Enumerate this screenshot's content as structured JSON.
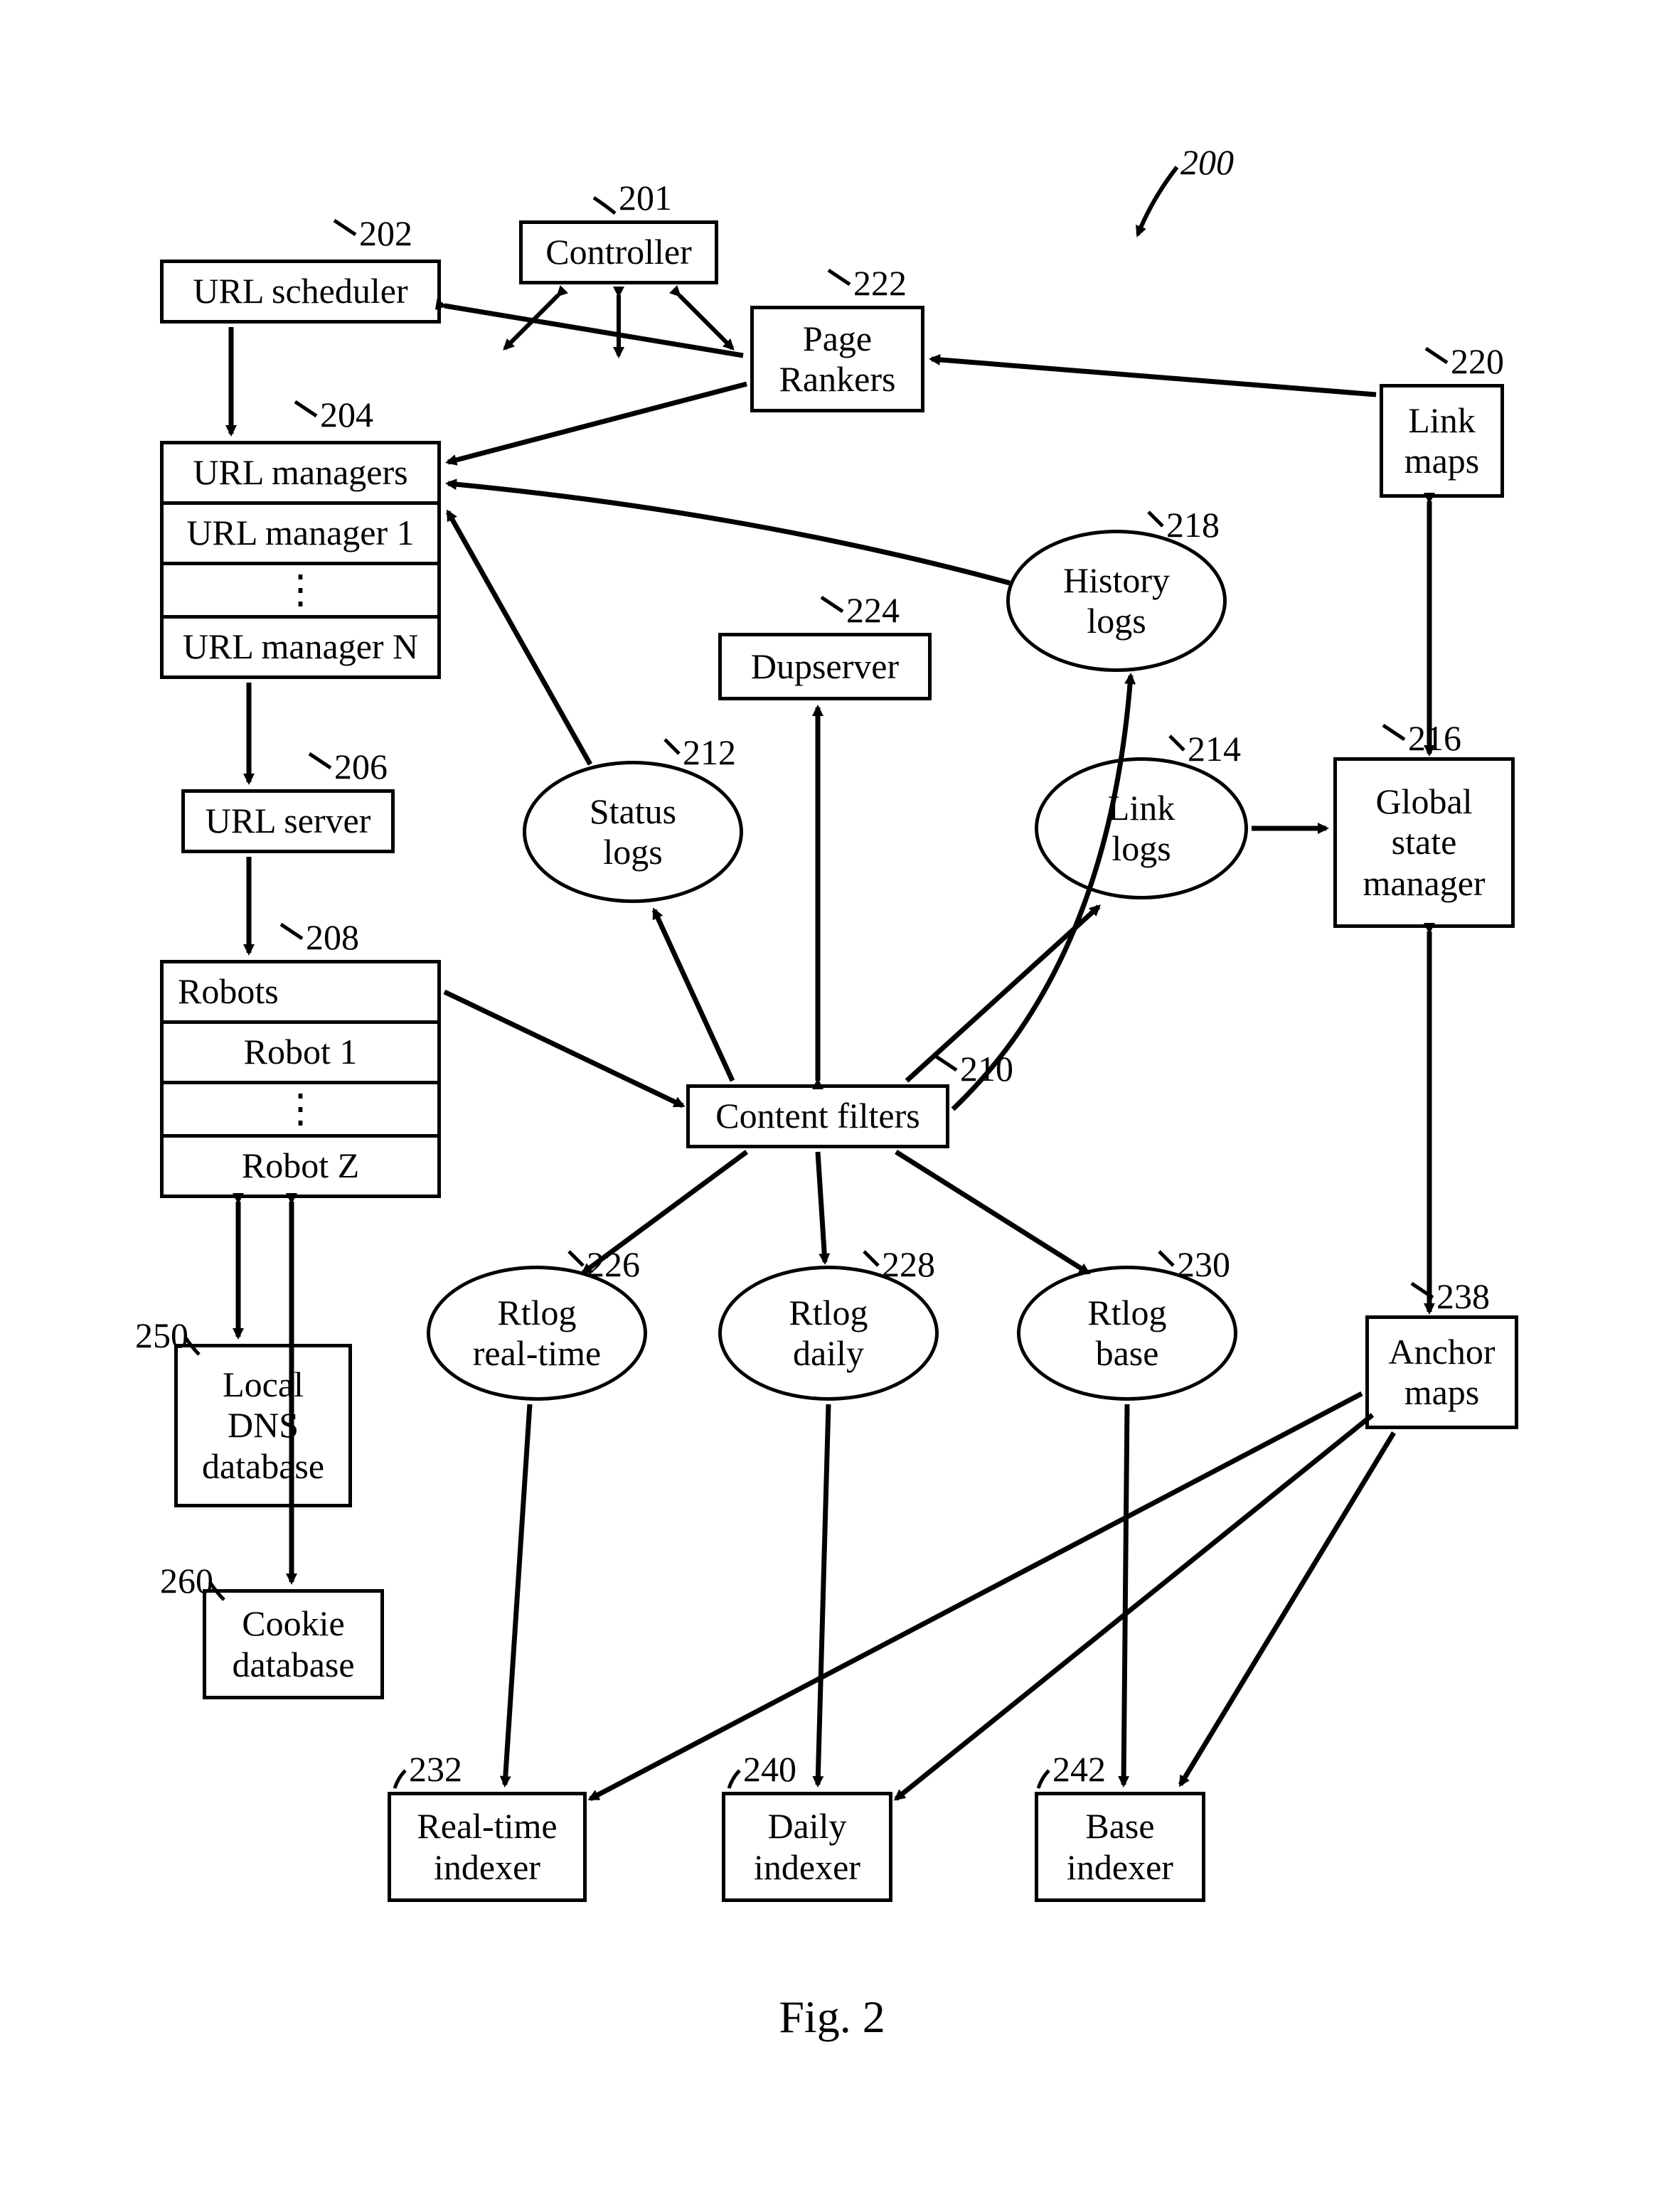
{
  "figure_label": "Fig. 2",
  "ref200": "200",
  "nodes": {
    "controller": {
      "text": "Controller",
      "ref": "201"
    },
    "url_scheduler": {
      "text": "URL scheduler",
      "ref": "202"
    },
    "url_managers_hdr": {
      "text": "URL managers",
      "ref": "204"
    },
    "url_manager_1": {
      "text": "URL manager 1"
    },
    "url_manager_dots": {
      "text": "⋮"
    },
    "url_manager_n": {
      "text": "URL manager N"
    },
    "url_server": {
      "text": "URL server",
      "ref": "206"
    },
    "robots_hdr": {
      "text": "Robots",
      "ref": "208"
    },
    "robot_1": {
      "text": "Robot 1"
    },
    "robot_dots": {
      "text": "⋮"
    },
    "robot_z": {
      "text": "Robot Z"
    },
    "local_dns": {
      "text": "Local\nDNS\ndatabase",
      "ref": "250"
    },
    "cookie_db": {
      "text": "Cookie\ndatabase",
      "ref": "260"
    },
    "content_filters": {
      "text": "Content filters",
      "ref": "210"
    },
    "status_logs": {
      "text": "Status\nlogs",
      "ref": "212"
    },
    "link_logs": {
      "text": "Link\nlogs",
      "ref": "214"
    },
    "history_logs": {
      "text": "History\nlogs",
      "ref": "218"
    },
    "dupserver": {
      "text": "Dupserver",
      "ref": "224"
    },
    "page_rankers": {
      "text": "Page\nRankers",
      "ref": "222"
    },
    "link_maps": {
      "text": "Link\nmaps",
      "ref": "220"
    },
    "global_state_mgr": {
      "text": "Global\nstate\nmanager",
      "ref": "216"
    },
    "anchor_maps": {
      "text": "Anchor\nmaps",
      "ref": "238"
    },
    "rtlog_realtime": {
      "text": "Rtlog\nreal-time",
      "ref": "226"
    },
    "rtlog_daily": {
      "text": "Rtlog\ndaily",
      "ref": "228"
    },
    "rtlog_base": {
      "text": "Rtlog\nbase",
      "ref": "230"
    },
    "realtime_indexer": {
      "text": "Real-time\nindexer",
      "ref": "232"
    },
    "daily_indexer": {
      "text": "Daily\nindexer",
      "ref": "240"
    },
    "base_indexer": {
      "text": "Base\nindexer",
      "ref": "242"
    }
  }
}
